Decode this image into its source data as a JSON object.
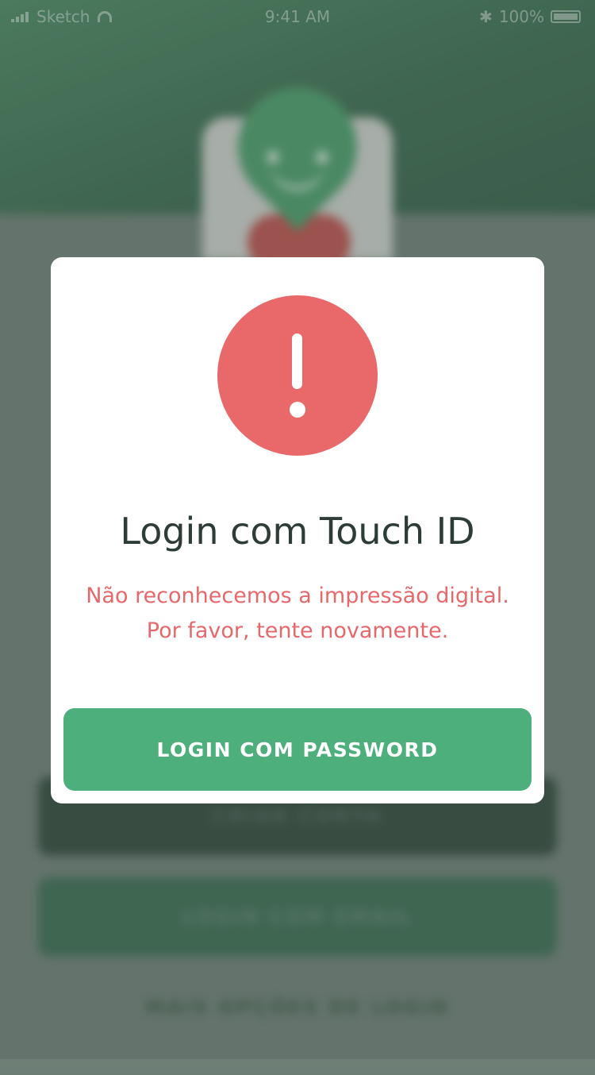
{
  "status_bar": {
    "carrier": "Sketch",
    "time": "9:41 AM",
    "battery_percent": "100%"
  },
  "background": {
    "create_account_label": "CRIAR CONTA",
    "login_email_label": "LOGIN COM EMAIL",
    "more_options_label": "MAIS OPÇÕES DE LOGIN"
  },
  "modal": {
    "title": "Login com Touch ID",
    "message_line1": "Não reconhecemos a impressão digital.",
    "message_line2": "Por favor, tente novamente.",
    "button_label": "LOGIN COM PASSWORD",
    "alert_icon": "exclamation-icon"
  },
  "colors": {
    "primary_green": "#4daf7c",
    "alert_red": "#e9696b",
    "title_text": "#2d3d35"
  }
}
